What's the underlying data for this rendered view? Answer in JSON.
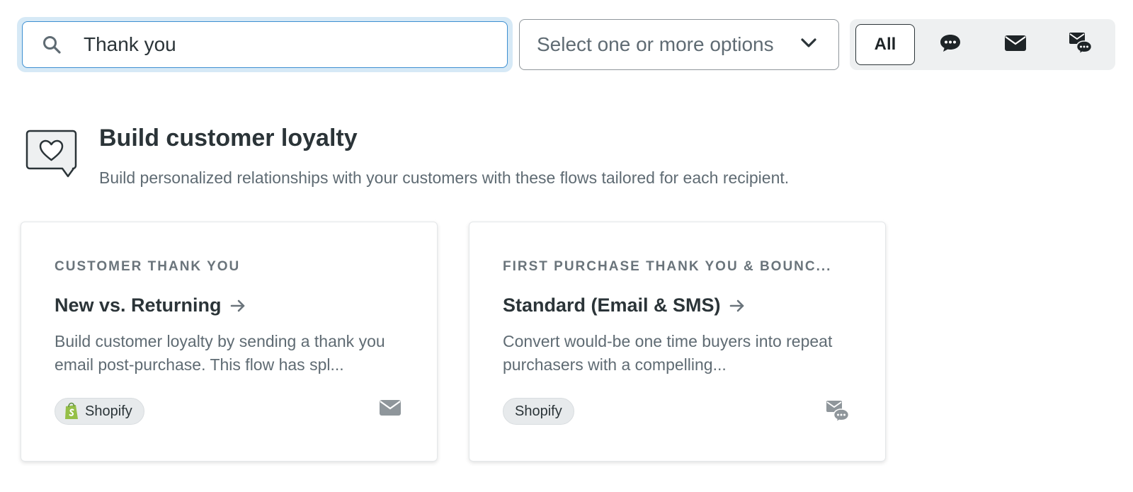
{
  "toolbar": {
    "search": {
      "value": "Thank you",
      "placeholder": ""
    },
    "select": {
      "placeholder": "Select one or more options"
    },
    "channels": {
      "all_label": "All",
      "items": [
        {
          "name": "all",
          "icon": ""
        },
        {
          "name": "sms",
          "icon": "chat-bubble-icon"
        },
        {
          "name": "email",
          "icon": "envelope-icon"
        },
        {
          "name": "email-sms",
          "icon": "envelope-chat-icon"
        }
      ]
    }
  },
  "section": {
    "icon": "heart-speech-bubble-icon",
    "title": "Build customer loyalty",
    "description": "Build personalized relationships with your customers with these flows tailored for each recipient."
  },
  "cards": [
    {
      "eyebrow": "CUSTOMER THANK YOU",
      "title": "New vs. Returning",
      "description": "Build customer loyalty by sending a thank you email post-purchase. This flow has spl...",
      "tag": "Shopify",
      "tag_has_logo": true,
      "channel_icon": "envelope-icon"
    },
    {
      "eyebrow": "FIRST PURCHASE THANK YOU & BOUNC...",
      "title": "Standard (Email & SMS)",
      "description": "Convert would-be one time buyers into repeat purchasers with a compelling...",
      "tag": "Shopify",
      "tag_has_logo": false,
      "channel_icon": "envelope-chat-icon"
    }
  ],
  "colors": {
    "focus": "#3d8fd1",
    "text": "#2b3438",
    "muted": "#5f6b73",
    "shopify_green": "#95bf47"
  }
}
